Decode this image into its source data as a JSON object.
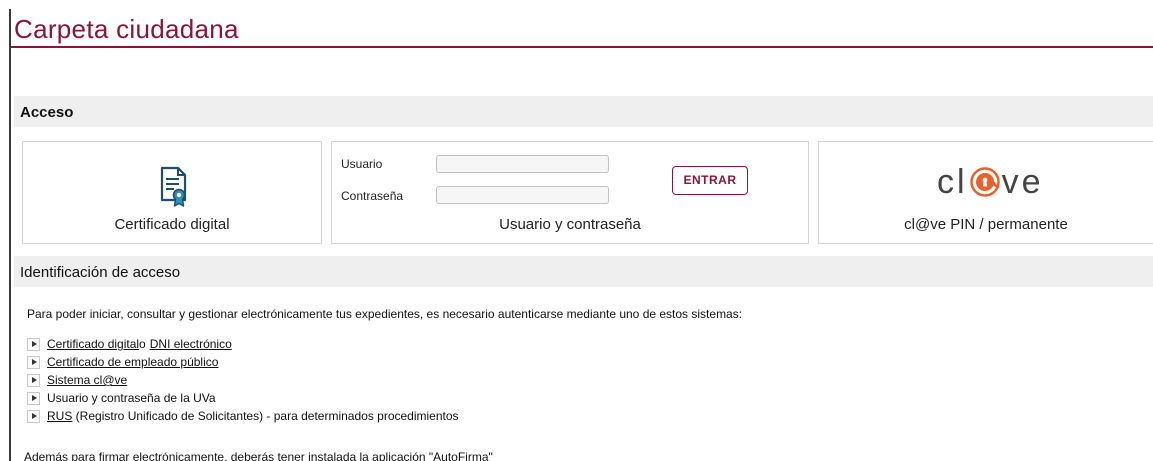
{
  "header": {
    "title": "Carpeta ciudadana"
  },
  "acceso": {
    "heading": "Acceso",
    "certificado": {
      "caption": "Certificado digital",
      "icon": "certificate-icon"
    },
    "usuario": {
      "user_label": "Usuario",
      "pass_label": "Contraseña",
      "user_value": "",
      "pass_value": "",
      "button": "ENTRAR",
      "caption": "Usuario y contraseña"
    },
    "clave": {
      "logo_left": "cl",
      "logo_right": "ve",
      "caption": "cl@ve PIN / permanente"
    }
  },
  "identificacion": {
    "heading": "Identificación de acceso",
    "intro": "Para poder iniciar, consultar y gestionar electrónicamente tus expedientes, es necesario autenticarse mediante uno de estos sistemas:",
    "options": {
      "cert_link": "Certificado digital ",
      "cert_sep": "o",
      "dni_link": "DNI electrónico",
      "empleado_link": "Certificado de empleado público",
      "clave_link": "Sistema cl@ve",
      "uva": "Usuario y contraseña de la UVa",
      "rus_link": "RUS",
      "rus_text": " (Registro Unificado de Solicitantes) - para determinados procedimientos"
    },
    "footnote": "Además para firmar electrónicamente, deberás tener instalada la aplicación  \"AutoFirma\""
  },
  "colors": {
    "brand": "#8a1538",
    "bar": "#efefef",
    "clave_orange": "#e8612c"
  }
}
